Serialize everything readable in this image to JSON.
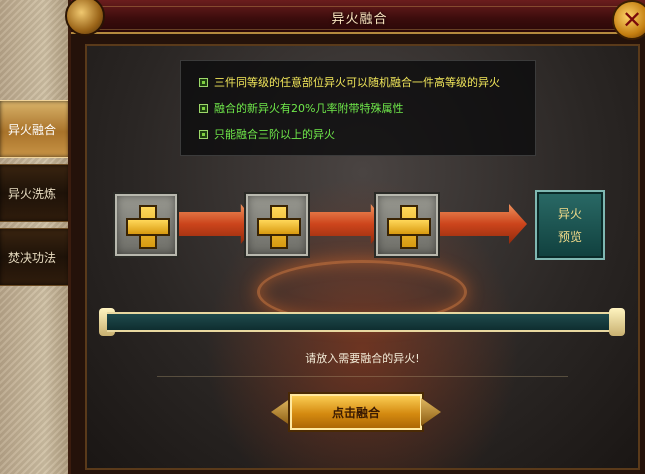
{
  "window": {
    "title": "异火融合",
    "close_icon": "close-icon"
  },
  "sidebar": {
    "items": [
      {
        "label": "异火融合",
        "active": true
      },
      {
        "label": "异火洗炼",
        "active": false
      },
      {
        "label": "焚决功法",
        "active": false
      }
    ]
  },
  "info": {
    "lines": [
      {
        "text": "三件同等级的任意部位异火可以随机融合一件高等级的异火",
        "color": "#f1e65a"
      },
      {
        "text": "融合的新异火有20%几率附带特殊属性",
        "color": "#6fe84a"
      },
      {
        "text": "只能融合三阶以上的异火",
        "color": "#6fe84a"
      }
    ]
  },
  "slots": [
    {
      "icon": "plus-icon"
    },
    {
      "icon": "plus-icon"
    },
    {
      "icon": "plus-icon"
    }
  ],
  "preview": {
    "line1": "异火",
    "line2": "预览"
  },
  "hint": "请放入需要融合的异火!",
  "fuse_button": {
    "label": "点击融合"
  }
}
